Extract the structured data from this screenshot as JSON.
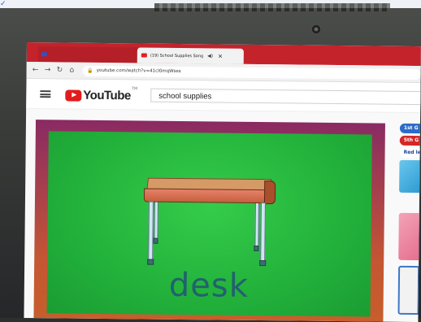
{
  "browser": {
    "tabs": [
      {
        "label": "",
        "active": false
      },
      {
        "label": "(19) School Supplies Song",
        "active": true
      }
    ],
    "url": "youtube.com/watch?v=41cI0mqWses"
  },
  "youtube": {
    "logo_text": "YouTube",
    "logo_superscript": "TM",
    "search_value": "school supplies"
  },
  "video": {
    "caption": "desk"
  },
  "sidebar": {
    "pills": [
      "1st G",
      "5th G",
      "Red le"
    ]
  },
  "colors": {
    "tab_bar": "#c4232c",
    "video_background": "#22b13b",
    "caption_text": "#22616e",
    "youtube_red": "#e31b1b"
  }
}
